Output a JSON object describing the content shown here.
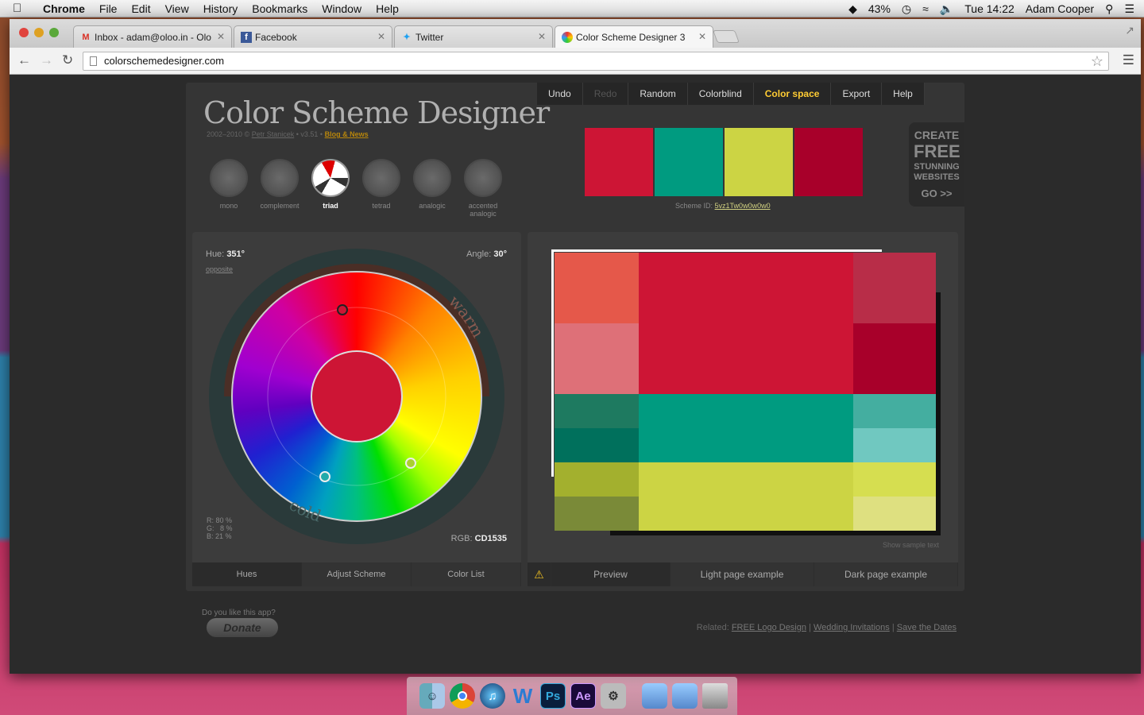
{
  "menubar": {
    "app": "Chrome",
    "items": [
      "File",
      "Edit",
      "View",
      "History",
      "Bookmarks",
      "Window",
      "Help"
    ],
    "battery": "43%",
    "clock": "Tue 14:22",
    "user": "Adam Cooper"
  },
  "tabs": [
    {
      "title": "Inbox - adam@oloo.in - Olo",
      "icon": "gmail-icon"
    },
    {
      "title": "Facebook",
      "icon": "facebook-icon"
    },
    {
      "title": "Twitter",
      "icon": "twitter-icon"
    },
    {
      "title": "Color Scheme Designer 3",
      "icon": "color-icon"
    }
  ],
  "address": "colorschemedesigner.com",
  "app": {
    "menu": [
      "Undo",
      "Redo",
      "Random",
      "Colorblind",
      "Color space",
      "Export",
      "Help"
    ],
    "title": "Color Scheme Designer",
    "credit_year": "2002–2010 ©",
    "credit_author": "Petr Stanicek",
    "credit_version": "• v3.51 •",
    "blog": "Blog & News",
    "schemes": [
      "mono",
      "complement",
      "triad",
      "tetrad",
      "analogic",
      "accented analogic"
    ],
    "active_scheme": "triad",
    "swatches": [
      "#CD1535",
      "#009B80",
      "#CCD444",
      "#A8002A"
    ],
    "scheme_id_label": "Scheme ID:",
    "scheme_id": "5vz1Tw0w0w0w0",
    "promo": {
      "l1": "CREATE",
      "l2": "FREE",
      "l3": "STUNNING",
      "l4": "WEBSITES",
      "go": "GO >>"
    },
    "hue_label": "Hue:",
    "hue_value": "351°",
    "opposite": "opposite",
    "angle_label": "Angle:",
    "angle_value": "30°",
    "warm": "warm",
    "cold": "cold",
    "rgb_pct": {
      "r": "R: 80 %",
      "g": "G:   8 %",
      "b": "B: 21 %"
    },
    "rgb_label": "RGB:",
    "rgb_value": "CD1535",
    "wheel_tabs": [
      "Hues",
      "Adjust Scheme",
      "Color List"
    ],
    "preview_tabs": [
      "Preview",
      "Light page example",
      "Dark page example"
    ],
    "sample_text": "Show sample text",
    "donate_q": "Do you like this app?",
    "donate": "Donate",
    "related_label": "Related:",
    "related_links": [
      "FREE Logo Design",
      "Wedding Invitations",
      "Save the Dates"
    ]
  },
  "palette": {
    "row1": [
      "#E5584A",
      "#CD1535",
      "#B82D48"
    ],
    "row2": [
      "#DE7078",
      "#CD1535",
      "#A8002A"
    ],
    "row3": [
      "#1E7A60",
      "#009B80",
      "#44AEA0"
    ],
    "row4": [
      "#00705C",
      "#009B80",
      "#70C8C0"
    ],
    "row5": [
      "#A3B02E",
      "#CCD444",
      "#D6DE50"
    ],
    "row6": [
      "#7A8A38",
      "#CCD444",
      "#DEE080"
    ]
  }
}
